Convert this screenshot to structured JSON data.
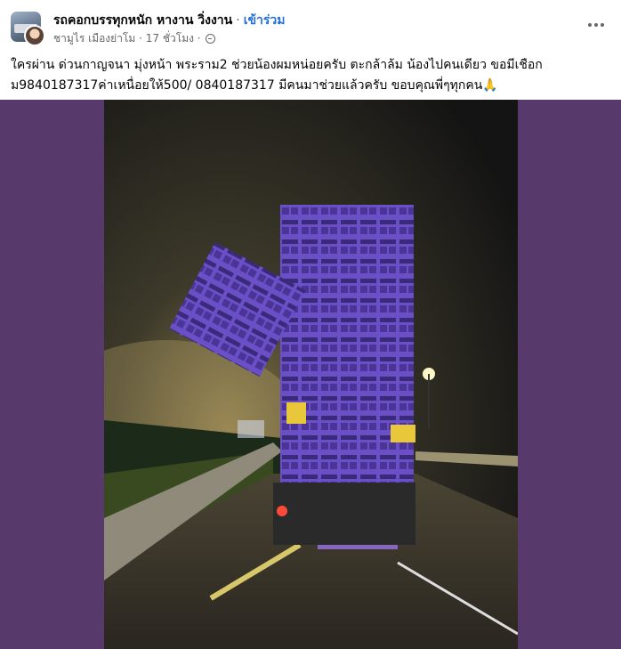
{
  "post": {
    "group_name": "รถคอกบรรทุกหนัก หางาน วิ่งงาน",
    "separator": "·",
    "join_label": "เข้าร่วม",
    "author": "ชามูไร เมืองย่าโม",
    "time": "17 ชั่วโมง",
    "text": "ใครผ่าน ด่วนกาญจนา มุ่งหน้า พระราม2 ช่วยน้องผมหน่อยครับ ตะกล้าล้ม น้องไปคนเดียว ขอมีเชือก ม9840187317ค่าเหนื่อยให้500/ 0840187317 มีคนมาช่วยแล้วครับ ขอบคุณพี่ๆทุกคน🙏",
    "more_icon": "more-horizontal-icon",
    "privacy_icon": "globe-icon"
  },
  "colors": {
    "join": "#216fdb",
    "photo_background": "#57396b",
    "crates": "#6a4fc6"
  }
}
